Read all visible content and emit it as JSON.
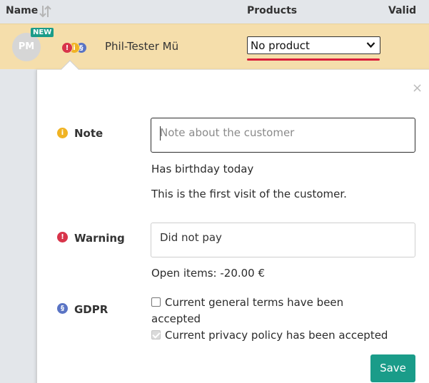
{
  "header": {
    "name_label": "Name",
    "products_label": "Products",
    "valid_label": "Valid"
  },
  "row": {
    "avatar_initials": "PM",
    "new_badge": "NEW",
    "status_dots": [
      "!",
      "i",
      "§"
    ],
    "customer_name": "Phil-Tester Mü",
    "product_value": "No product"
  },
  "popover": {
    "close": "×",
    "note": {
      "icon": "i",
      "label": "Note",
      "placeholder": "Note about the customer",
      "info_lines": [
        "Has birthday today",
        "This is the first visit of the customer."
      ]
    },
    "warning": {
      "icon": "!",
      "label": "Warning",
      "value": "Did not pay",
      "open_items": "Open items: -20.00 €"
    },
    "gdpr": {
      "icon": "§",
      "label": "GDPR",
      "terms_label_line1": "Current general terms have been",
      "terms_label_line2": "accepted",
      "terms_checked": false,
      "privacy_label": "Current privacy policy has been accepted",
      "privacy_checked": true
    },
    "save_label": "Save"
  },
  "colors": {
    "row_highlight": "#f5deab",
    "accent": "#1a9c89",
    "warning": "#d8344a",
    "note": "#f0b323",
    "gdpr": "#5a74c4",
    "error_underline": "#d91f3a"
  }
}
